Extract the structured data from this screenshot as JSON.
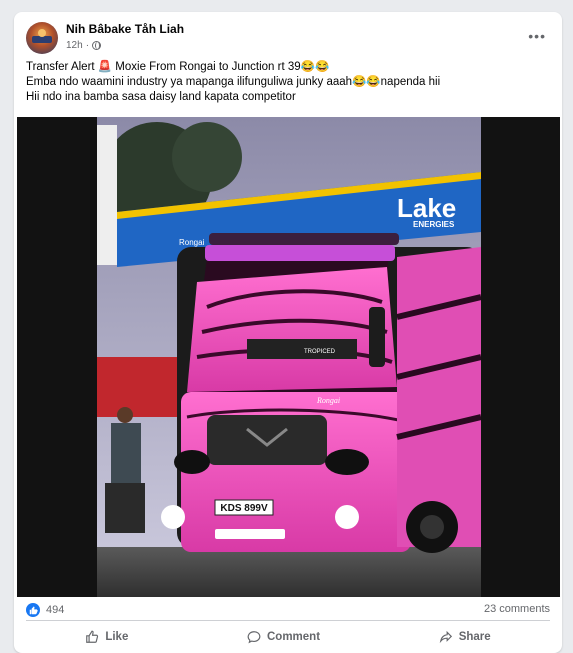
{
  "post": {
    "author": "Nih Bâbake Tåh Liah",
    "time": "12h",
    "more": "•••",
    "lines": [
      "Transfer Alert 🚨 Moxie From Rongai to Junction rt 39😂😂",
      "Emba ndo waamini industry ya mapanga ilifunguliwa junky aaah😂😂napenda hii",
      " Hii ndo ina bamba sasa daisy land kapata competitor"
    ]
  },
  "photo": {
    "sign_text": "Lake",
    "sign_sub": "ENERGIES",
    "plate": "KDS 899V",
    "script": "Rongai",
    "brand": "Rongai",
    "emblem": "TROPICED"
  },
  "engagement": {
    "likes": "494",
    "comments": "23 comments"
  },
  "actions": {
    "like": "Like",
    "comment": "Comment",
    "share": "Share"
  }
}
